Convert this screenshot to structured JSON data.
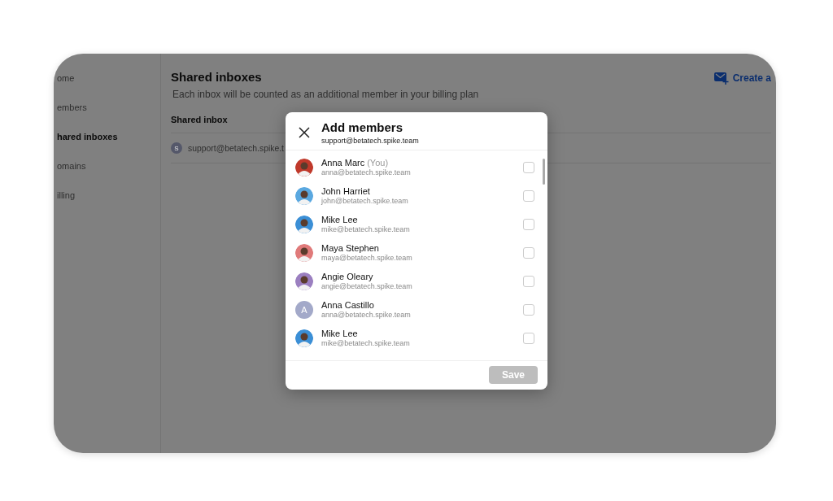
{
  "sidebar": {
    "items": [
      {
        "label": "ome",
        "selected": false
      },
      {
        "label": "embers",
        "selected": false
      },
      {
        "label": "hared inboxes",
        "selected": true
      },
      {
        "label": "omains",
        "selected": false
      },
      {
        "label": "illing",
        "selected": false
      }
    ]
  },
  "main": {
    "title": "Shared inboxes",
    "subtitle": "Each inbox will be counted as an additional member in your billing plan",
    "create_button": "Create a",
    "table": {
      "column": "Shared inbox",
      "rows": [
        {
          "initial": "S",
          "address": "support@betatech.spike.t"
        }
      ]
    }
  },
  "dialog": {
    "title": "Add members",
    "subtitle": "support@betatech.spike.team",
    "members": [
      {
        "name": "Anna Marc",
        "note": "(You)",
        "email": "anna@betatech.spike.team",
        "avatar": {
          "kind": "photo",
          "color": "#c0392b"
        },
        "checked": false
      },
      {
        "name": "John Harriet",
        "email": "john@betatech.spike.team",
        "avatar": {
          "kind": "photo",
          "color": "#5aa8e0"
        },
        "checked": false
      },
      {
        "name": "Mike Lee",
        "email": "mike@betatech.spike.team",
        "avatar": {
          "kind": "photo",
          "color": "#3b8fd6"
        },
        "checked": false
      },
      {
        "name": "Maya Stephen",
        "email": "maya@betatech.spike.team",
        "avatar": {
          "kind": "photo",
          "color": "#e07a7a"
        },
        "checked": false
      },
      {
        "name": "Angie Oleary",
        "email": "angie@betatech.spike.team",
        "avatar": {
          "kind": "photo",
          "color": "#9b7fc0"
        },
        "checked": false
      },
      {
        "name": "Anna Castillo",
        "email": "anna@betatech.spike.team",
        "avatar": {
          "kind": "initial",
          "letter": "A",
          "color": "#a3a9c9"
        },
        "checked": false
      },
      {
        "name": "Mike Lee",
        "email": "mike@betatech.spike.team",
        "avatar": {
          "kind": "photo",
          "color": "#3b8fd6"
        },
        "checked": false
      }
    ],
    "save": {
      "label": "Save",
      "disabled": true
    }
  }
}
